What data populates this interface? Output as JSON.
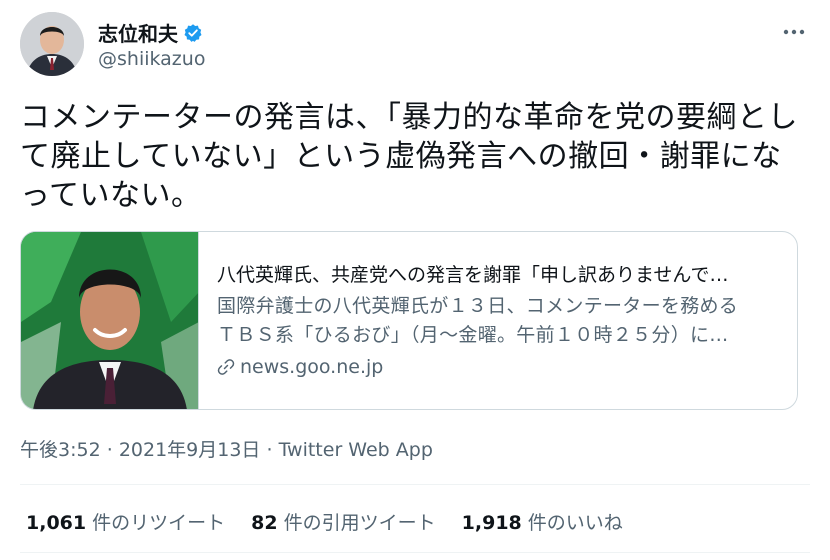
{
  "tweet": {
    "author": {
      "display_name": "志位和夫",
      "handle": "@shiikazuo",
      "verified": true
    },
    "text": "コメンテーターの発言は、「暴力的な革命を党の要綱として廃止していない」という虚偽発言への撤回・謝罪になっていない。",
    "card": {
      "title": "八代英輝氏、共産党への発言を謝罪「申し訳ありませんで…",
      "description_line1": "国際弁護士の八代英輝氏が１３日、コメンテーターを務める",
      "description_line2": "ＴＢＳ系「ひるおび」（月～金曜。午前１０時２５分）に…",
      "domain": "news.goo.ne.jp"
    },
    "meta": {
      "time": "午後3:52",
      "date": "2021年9月13日",
      "source": "Twitter Web App"
    },
    "stats": {
      "retweets_count": "1,061",
      "retweets_label": " 件のリツイート",
      "quotes_count": "82",
      "quotes_label": " 件の引用ツイート",
      "likes_count": "1,918",
      "likes_label": " 件のいいね"
    }
  },
  "icons": {
    "verified": "verified-badge-icon",
    "more": "more-icon",
    "link": "link-icon"
  },
  "colors": {
    "text": "#0f1419",
    "secondary": "#536471",
    "verified_blue": "#1d9bf0",
    "border": "#cfd9de"
  }
}
